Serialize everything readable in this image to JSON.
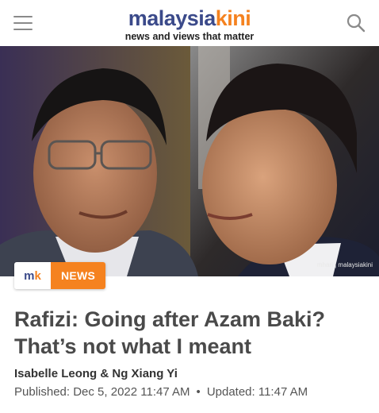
{
  "header": {
    "logo_part1": "malaysia",
    "logo_part2": "kini",
    "tagline": "news and views that matter",
    "brand_blue": "#3b4a8a",
    "brand_orange": "#f5821f"
  },
  "hero": {
    "photo_credit": "mhari | malaysiakini"
  },
  "badge": {
    "logo_m": "m",
    "logo_k": "k",
    "category": "NEWS"
  },
  "article": {
    "headline": "Rafizi: Going after Azam Baki? That’s not what I meant",
    "authors": "Isabelle Leong & Ng Xiang Yi",
    "published": "Published:  Dec 5, 2022 11:47 AM",
    "separator": "•",
    "updated": "Updated: 11:47 AM"
  }
}
